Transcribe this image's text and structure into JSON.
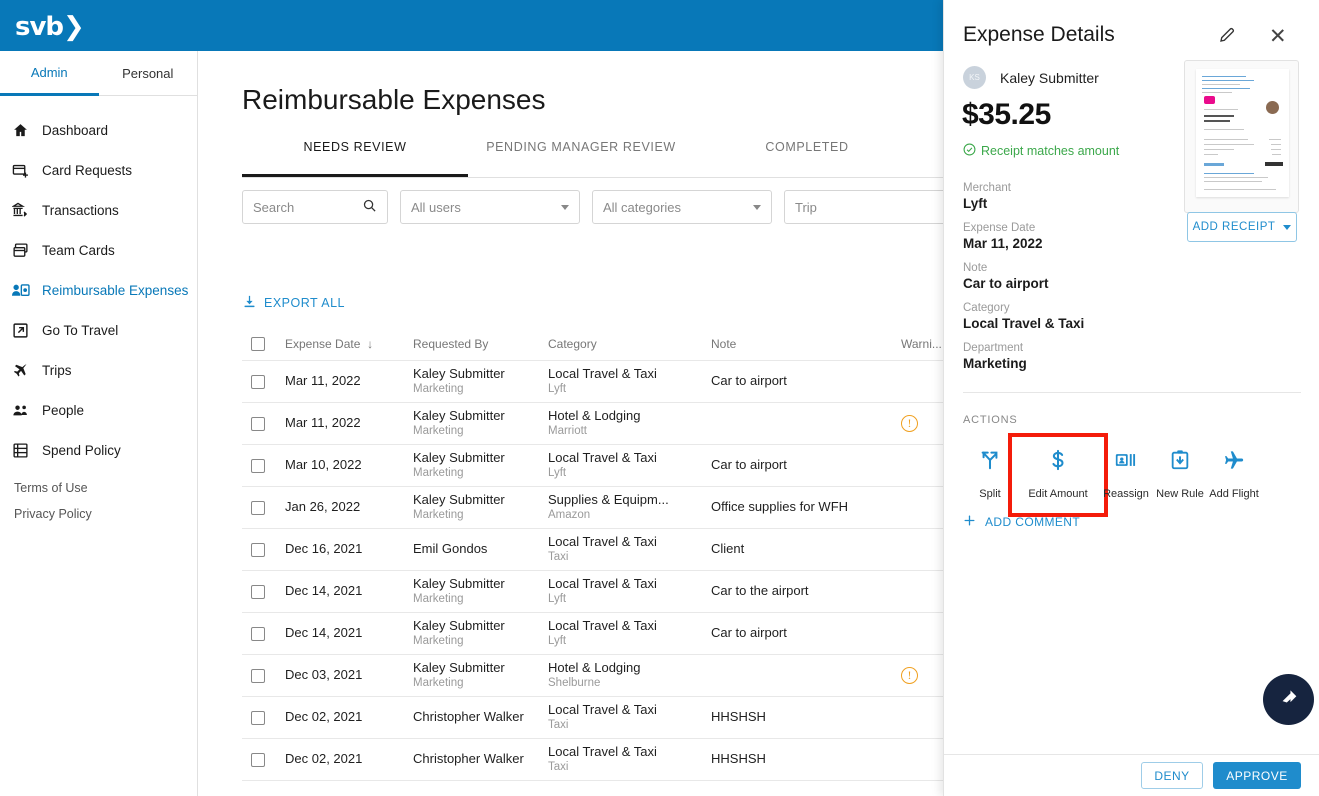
{
  "brand": {
    "logo_text": "svb",
    "header_color": "#0878b8",
    "accent_color": "#1f8ccc"
  },
  "top_tabs": [
    {
      "label": "Admin",
      "active": true
    },
    {
      "label": "Personal",
      "active": false
    }
  ],
  "sidebar": {
    "items": [
      {
        "label": "Dashboard",
        "icon": "home-icon",
        "active": false
      },
      {
        "label": "Card Requests",
        "icon": "card-plus-icon",
        "active": false
      },
      {
        "label": "Transactions",
        "icon": "transactions-icon",
        "active": false
      },
      {
        "label": "Team Cards",
        "icon": "team-cards-icon",
        "active": false
      },
      {
        "label": "Reimbursable Expenses",
        "icon": "person-card-icon",
        "active": true
      },
      {
        "label": "Go To Travel",
        "icon": "external-link-icon",
        "active": false
      },
      {
        "label": "Trips",
        "icon": "airplane-icon",
        "active": false
      },
      {
        "label": "People",
        "icon": "people-icon",
        "active": false
      },
      {
        "label": "Spend Policy",
        "icon": "policy-list-icon",
        "active": false
      }
    ],
    "footer_links": [
      "Terms of Use",
      "Privacy Policy"
    ]
  },
  "main": {
    "title": "Reimbursable Expenses",
    "tabs": [
      {
        "label": "NEEDS REVIEW",
        "active": true
      },
      {
        "label": "PENDING MANAGER REVIEW",
        "active": false
      },
      {
        "label": "COMPLETED",
        "active": false
      }
    ],
    "filters": {
      "search_placeholder": "Search",
      "users_value": "All users",
      "categories_value": "All categories",
      "trip_placeholder": "Trip"
    },
    "export_label": "EXPORT ALL",
    "table": {
      "columns": [
        "Expense Date",
        "Requested By",
        "Category",
        "Note",
        "Warni..."
      ],
      "sort_column": "Expense Date",
      "sort_direction": "desc",
      "rows": [
        {
          "date": "Mar 11, 2022",
          "by": "Kaley Submitter",
          "dept": "Marketing",
          "category": "Local Travel & Taxi",
          "merchant": "Lyft",
          "note": "Car to airport",
          "warning": false
        },
        {
          "date": "Mar 11, 2022",
          "by": "Kaley Submitter",
          "dept": "Marketing",
          "category": "Hotel & Lodging",
          "merchant": "Marriott",
          "note": "",
          "warning": true
        },
        {
          "date": "Mar 10, 2022",
          "by": "Kaley Submitter",
          "dept": "Marketing",
          "category": "Local Travel & Taxi",
          "merchant": "Lyft",
          "note": "Car to airport",
          "warning": false
        },
        {
          "date": "Jan 26, 2022",
          "by": "Kaley Submitter",
          "dept": "Marketing",
          "category": "Supplies & Equipm...",
          "merchant": "Amazon",
          "note": "Office supplies for WFH",
          "warning": false
        },
        {
          "date": "Dec 16, 2021",
          "by": "Emil Gondos",
          "dept": "",
          "category": "Local Travel & Taxi",
          "merchant": "Taxi",
          "note": "Client",
          "warning": false
        },
        {
          "date": "Dec 14, 2021",
          "by": "Kaley Submitter",
          "dept": "Marketing",
          "category": "Local Travel & Taxi",
          "merchant": "Lyft",
          "note": "Car to the airport",
          "warning": false
        },
        {
          "date": "Dec 14, 2021",
          "by": "Kaley Submitter",
          "dept": "Marketing",
          "category": "Local Travel & Taxi",
          "merchant": "Lyft",
          "note": "Car to airport",
          "warning": false
        },
        {
          "date": "Dec 03, 2021",
          "by": "Kaley Submitter",
          "dept": "Marketing",
          "category": "Hotel & Lodging",
          "merchant": "Shelburne",
          "note": "",
          "warning": true
        },
        {
          "date": "Dec 02, 2021",
          "by": "Christopher Walker",
          "dept": "",
          "category": "Local Travel & Taxi",
          "merchant": "Taxi",
          "note": "HHSHSH",
          "warning": false
        },
        {
          "date": "Dec 02, 2021",
          "by": "Christopher Walker",
          "dept": "",
          "category": "Local Travel & Taxi",
          "merchant": "Taxi",
          "note": "HHSHSH",
          "warning": false
        }
      ]
    }
  },
  "panel": {
    "title": "Expense Details",
    "user_initials": "KS",
    "user_name": "Kaley Submitter",
    "amount": "$35.25",
    "match_text": "Receipt matches amount",
    "match_color": "#3ca84b",
    "fields": [
      {
        "label": "Merchant",
        "value": "Lyft"
      },
      {
        "label": "Expense Date",
        "value": "Mar 11, 2022"
      },
      {
        "label": "Note",
        "value": "Car to airport"
      },
      {
        "label": "Category",
        "value": "Local Travel & Taxi"
      },
      {
        "label": "Department",
        "value": "Marketing"
      }
    ],
    "add_receipt_label": "ADD RECEIPT",
    "actions_heading": "ACTIONS",
    "actions": [
      {
        "label": "Split",
        "icon": "split-arrow-icon",
        "highlighted": false
      },
      {
        "label": "Edit Amount",
        "icon": "dollar-sign-icon",
        "highlighted": true
      },
      {
        "label": "Reassign",
        "icon": "reassign-id-icon",
        "highlighted": false
      },
      {
        "label": "New Rule",
        "icon": "new-rule-clipboard-icon",
        "highlighted": false
      },
      {
        "label": "Add Flight",
        "icon": "airplane-icon",
        "highlighted": false
      }
    ],
    "highlight_color": "#f41c0a",
    "add_comment_label": "ADD COMMENT",
    "deny_label": "DENY",
    "approve_label": "APPROVE"
  },
  "fab": {
    "icon": "cursor-arrow-icon",
    "color": "#16243f"
  }
}
